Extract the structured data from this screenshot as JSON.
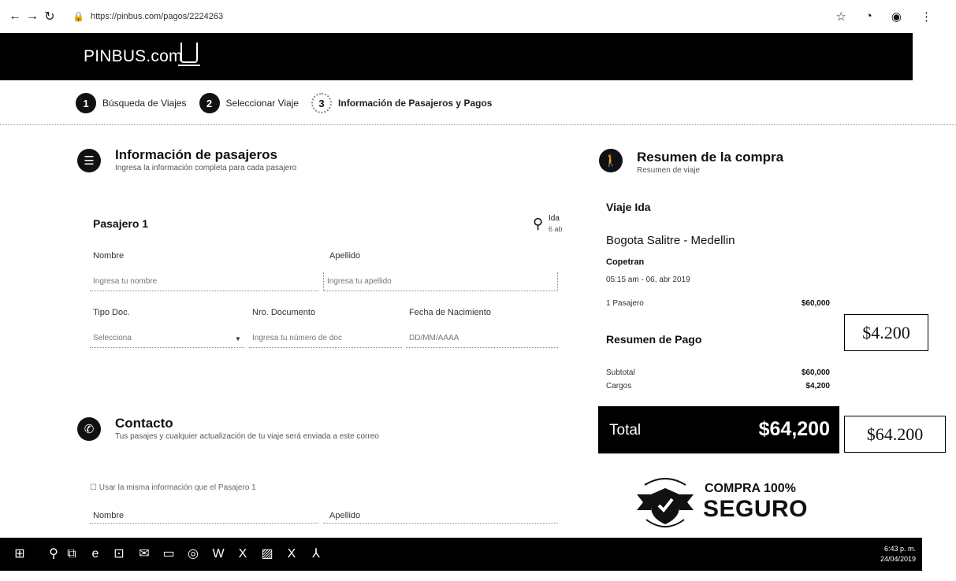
{
  "browser": {
    "url": "https://pinbus.com/pagos/2224263",
    "nav_icons": [
      "back-icon",
      "forward-icon",
      "reload-icon"
    ],
    "right_icons": [
      "star-icon",
      "extension-icon",
      "extension2-icon",
      "menu-icon"
    ]
  },
  "header": {
    "logo": "PINBUS.com"
  },
  "steps": [
    {
      "num": "1",
      "label": "Búsqueda de Viajes"
    },
    {
      "num": "2",
      "label": "Seleccionar Viaje"
    },
    {
      "num": "3",
      "label": "Información de Pasajeros y Pagos"
    }
  ],
  "passengers": {
    "title": "Información de pasajeros",
    "subtitle": "Ingresa la información completa para cada pasajero",
    "pax_title": "Pasajero 1",
    "ida_label": "Ida",
    "ida_sub": "6 ab",
    "nombre_label": "Nombre",
    "nombre_placeholder": "Ingresa tu nombre",
    "apellido_label": "Apellido",
    "apellido_placeholder": "Ingresa tu apellido",
    "tipo_label": "Tipo Doc.",
    "tipo_value": "Selecciona",
    "nro_label": "Nro. Documento",
    "nro_placeholder": "Ingresa tu número de doc",
    "fecha_label": "Fecha de Nacimiento",
    "fecha_placeholder": "DD/MM/AAAA"
  },
  "contact": {
    "title": "Contacto",
    "subtitle": "Tus pasajes y cualquier actualización de tu viaje será enviada a este correo",
    "checkbox_label": "Usar la misma información que el Pasajero 1",
    "nombre_label": "Nombre",
    "apellido_label": "Apellido"
  },
  "summary": {
    "title": "Resumen de la compra",
    "subtitle": "Resumen de viaje",
    "viaje_ida": "Viaje Ida",
    "route": "Bogota Salitre - Medellin",
    "company": "Copetran",
    "date": "05:15 am - 06, abr 2019",
    "pasajero_label": "1 Pasajero",
    "pasajero_value": "$60,000",
    "pago_title": "Resumen de Pago",
    "subtotal_label": "Subtotal",
    "subtotal_value": "$60,000",
    "cargos_label": "Cargos",
    "cargos_value": "$4,200",
    "total_label": "Total",
    "total_value": "$64,200"
  },
  "annotations": {
    "cargos": "$4.200",
    "total": "$64.200"
  },
  "badge": {
    "line1": "COMPRA 100%",
    "line2": "SEGURO"
  },
  "taskbar": {
    "icons": [
      "windows-start-icon",
      "search-icon",
      "task-view-icon",
      "edge-icon",
      "store-icon",
      "mail-icon",
      "explorer-icon",
      "chrome-icon",
      "word-icon",
      "excel-icon",
      "photos-icon",
      "excel2-icon",
      "acrobat-icon"
    ],
    "time": "6:43 p. m.",
    "date": "24/04/2019"
  }
}
